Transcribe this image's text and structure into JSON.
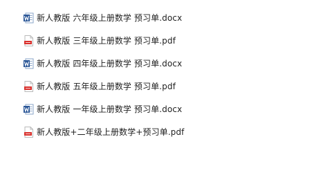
{
  "files": [
    {
      "name": "新人教版 六年级上册数学 预习单.docx",
      "icon": "word-doc-icon",
      "type": "docx"
    },
    {
      "name": "新人教版 三年级上册数学 预习单.pdf",
      "icon": "pdf-icon",
      "type": "pdf"
    },
    {
      "name": "新人教版 四年级上册数学 预习单.docx",
      "icon": "word-doc-icon",
      "type": "docx"
    },
    {
      "name": "新人教版 五年级上册数学 预习单.pdf",
      "icon": "pdf-icon",
      "type": "pdf"
    },
    {
      "name": "新人教版 一年级上册数学 预习单.docx",
      "icon": "word-doc-icon",
      "type": "docx"
    },
    {
      "name": "新人教版+二年级上册数学+预习单.pdf",
      "icon": "pdf-icon",
      "type": "pdf"
    }
  ],
  "colors": {
    "word_blue": "#2b5797",
    "pdf_red": "#d9302c",
    "text": "#1f1f1f"
  }
}
